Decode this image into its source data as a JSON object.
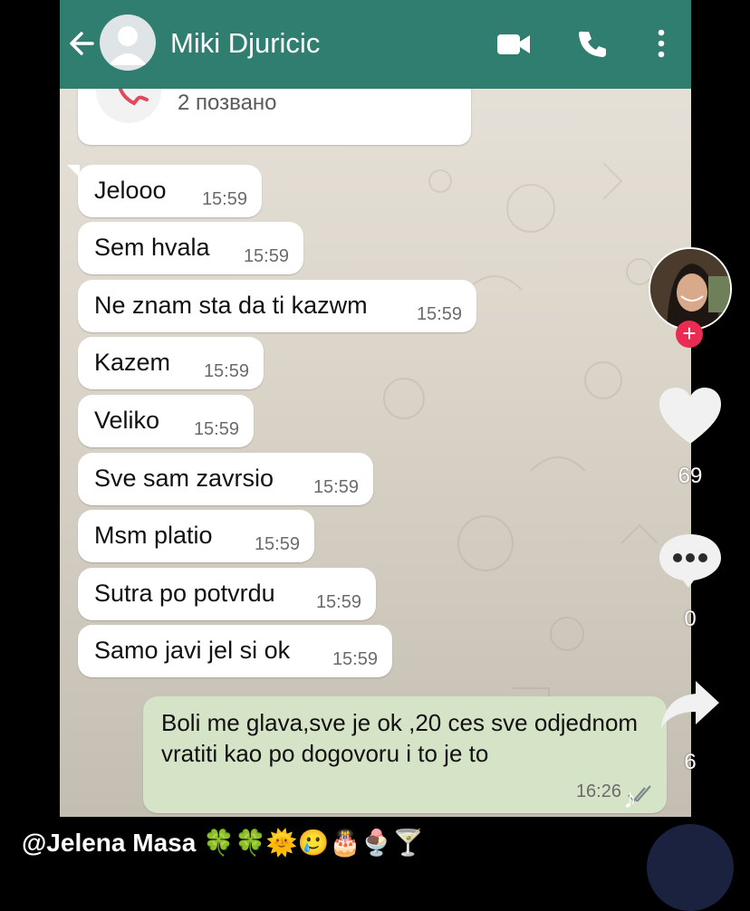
{
  "header": {
    "contact_name": "Miki Djuricic",
    "color": "#2f7e6f"
  },
  "call_card": {
    "status": "2 позвано"
  },
  "messages": [
    {
      "text": "Jelooo",
      "time": "15:59"
    },
    {
      "text": "Sem hvala",
      "time": "15:59"
    },
    {
      "text": "Ne znam sta da ti kazwm",
      "time": "15:59"
    },
    {
      "text": "Kazem",
      "time": "15:59"
    },
    {
      "text": "Veliko",
      "time": "15:59"
    },
    {
      "text": "Sve sam zavrsio",
      "time": "15:59"
    },
    {
      "text": "Msm platio",
      "time": "15:59"
    },
    {
      "text": "Sutra po potvrdu",
      "time": "15:59"
    },
    {
      "text": "Samo javi jel si ok",
      "time": "15:59"
    }
  ],
  "sent_message": {
    "text": "Boli me glava,sve je ok ,20 ces sve odjednom vratiti kao po dogovoru i to je to",
    "time": "16:26"
  },
  "tiktok": {
    "likes": "69",
    "comments": "0",
    "shares": "6",
    "follow_symbol": "+",
    "username": "@Jelena Masa 🍀🍀🌞🥲🎂🍨🍸",
    "accent": "#ea2b52"
  }
}
